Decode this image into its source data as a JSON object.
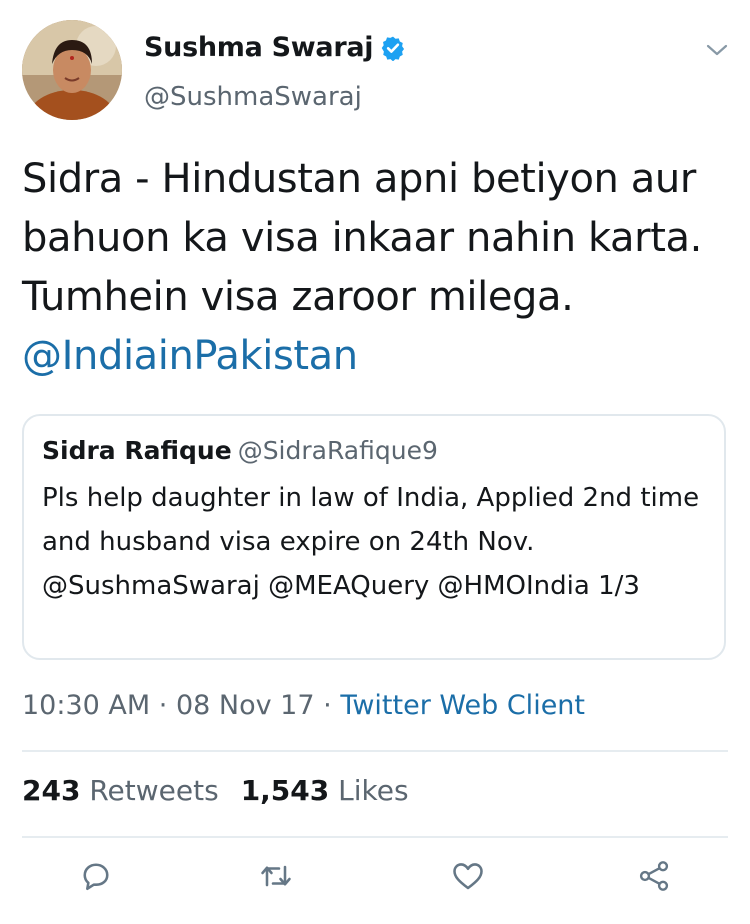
{
  "author": {
    "name": "Sushma Swaraj",
    "handle": "@SushmaSwaraj",
    "verified_icon": "verified-badge-icon",
    "avatar_icon": "profile-photo"
  },
  "tweet": {
    "text_part1": "Sidra - Hindustan apni betiyon aur bahuon ka visa inkaar nahin karta. Tumhein visa zaroor milega.",
    "mention": "@IndiainPakistan"
  },
  "quoted_tweet": {
    "name": "Sidra Rafique",
    "handle": "@SidraRafique9",
    "text": "Pls help daughter in law of India, Applied 2nd time and husband visa expire on 24th Nov. @SushmaSwaraj @MEAQuery @HMOIndia 1/3"
  },
  "meta": {
    "time": "10:30 AM",
    "separator": "·",
    "date": "08 Nov 17",
    "client": "Twitter Web Client"
  },
  "stats": {
    "retweets_count": "243",
    "retweets_label": "Retweets",
    "likes_count": "1,543",
    "likes_label": "Likes"
  },
  "actions": [
    "reply-icon",
    "retweet-icon",
    "like-icon",
    "share-icon"
  ],
  "colors": {
    "link": "#1b6ea8",
    "verified": "#1da1f2",
    "secondary_text": "#5b6670",
    "divider": "#e6ecf0"
  }
}
